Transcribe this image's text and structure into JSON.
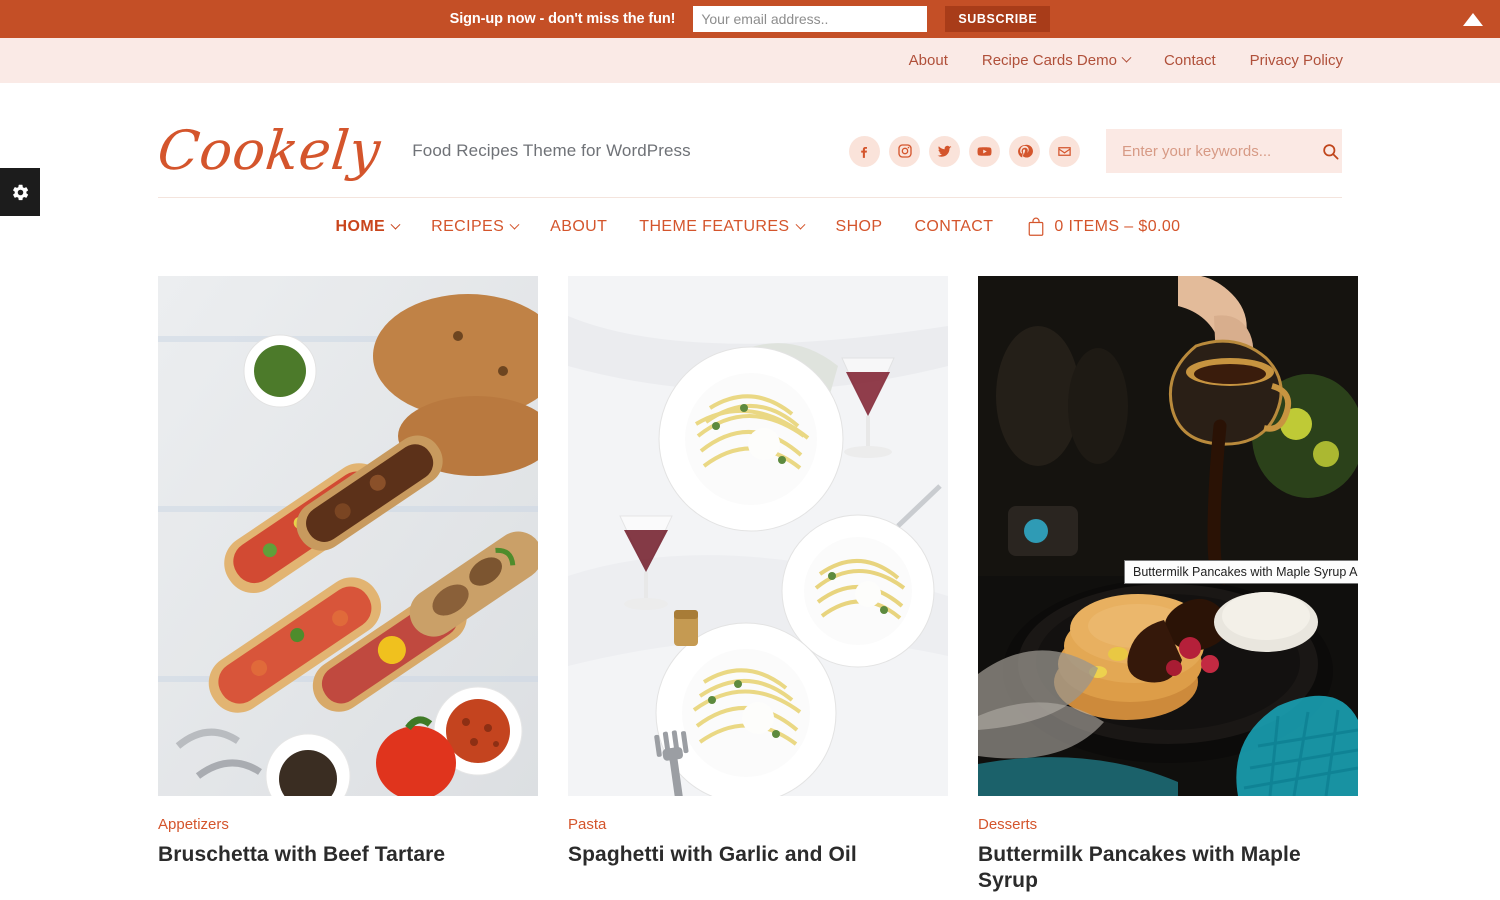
{
  "topbar": {
    "message": "Sign-up now - don't miss the fun!",
    "email_placeholder": "Your email address..",
    "subscribe_label": "SUBSCRIBE",
    "toggle_icon": "triangle-up-icon",
    "bg_color": "#c44f26",
    "button_color": "#a83c19"
  },
  "secondary_nav": {
    "items": [
      {
        "label": "About",
        "has_dropdown": false
      },
      {
        "label": "Recipe Cards Demo",
        "has_dropdown": true
      },
      {
        "label": "Contact",
        "has_dropdown": false
      },
      {
        "label": "Privacy Policy",
        "has_dropdown": false
      }
    ],
    "bg_color": "#faeae6",
    "text_color": "#b0503a"
  },
  "header": {
    "logo": "Cookely",
    "tagline": "Food Recipes Theme for WordPress",
    "socials": [
      {
        "name": "facebook-icon",
        "label": "Facebook"
      },
      {
        "name": "instagram-icon",
        "label": "Instagram"
      },
      {
        "name": "twitter-icon",
        "label": "Twitter"
      },
      {
        "name": "youtube-icon",
        "label": "YouTube"
      },
      {
        "name": "pinterest-icon",
        "label": "Pinterest"
      },
      {
        "name": "email-icon",
        "label": "Email"
      }
    ],
    "search_placeholder": "Enter your keywords...",
    "search_value": "",
    "accent_color": "#d4552c"
  },
  "main_nav": {
    "items": [
      {
        "label": "HOME",
        "has_dropdown": true,
        "active": true
      },
      {
        "label": "RECIPES",
        "has_dropdown": true,
        "active": false
      },
      {
        "label": "ABOUT",
        "has_dropdown": false,
        "active": false
      },
      {
        "label": "THEME FEATURES",
        "has_dropdown": true,
        "active": false
      },
      {
        "label": "SHOP",
        "has_dropdown": false,
        "active": false
      },
      {
        "label": "CONTACT",
        "has_dropdown": false,
        "active": false
      }
    ],
    "cart": {
      "icon": "shopping-bag-icon",
      "label": "0 ITEMS – $0.00"
    }
  },
  "cards": [
    {
      "category": "Appetizers",
      "title": "Bruschetta with Beef Tartare",
      "image_alt": "Assorted bruschetta with vegetables, mushrooms and beef tartare on a striped cloth"
    },
    {
      "category": "Pasta",
      "title": "Spaghetti with Garlic and Oil",
      "image_alt": "Two plates of spaghetti with red wine on a white tablecloth"
    },
    {
      "category": "Desserts",
      "title": "Buttermilk Pancakes with Maple Syrup",
      "image_alt": "Hand pouring maple syrup over a stack of pancakes in a dark skillet"
    }
  ],
  "tooltip": {
    "text": "Buttermilk Pancakes with Maple Syrup Apples"
  },
  "gear_tab": {
    "icon": "gear-icon",
    "label": "Theme Settings"
  }
}
